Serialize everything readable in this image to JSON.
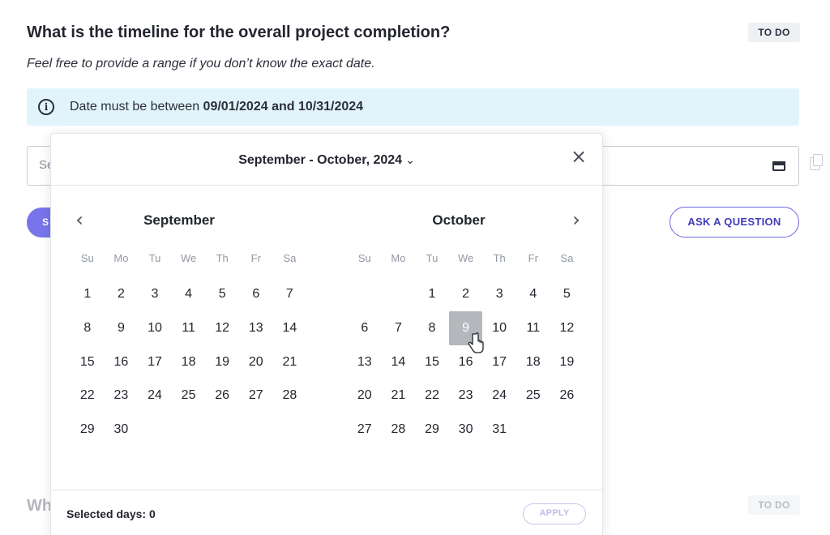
{
  "question": {
    "title": "What is the timeline for the overall project completion?",
    "hint": "Feel free to provide a range if you don’t know the exact date.",
    "status": "TO DO"
  },
  "info": {
    "prefix": "Date must be between ",
    "range": "09/01/2024 and 10/31/2024",
    "icon": "info-icon"
  },
  "date_input": {
    "placeholder": "Se",
    "icon": "calendar-icon"
  },
  "actions": {
    "submit_label": "S",
    "ask_label": "ASK A QUESTION"
  },
  "next_question": {
    "title": "Wh",
    "status": "TO DO"
  },
  "datepicker": {
    "title": "September - October, 2024",
    "title_chevron": "⌄",
    "close": "×",
    "prev": "‹",
    "next": "›",
    "weekdays": [
      "Su",
      "Mo",
      "Tu",
      "We",
      "Th",
      "Fr",
      "Sa"
    ],
    "months": [
      {
        "name": "September",
        "days": [
          "1",
          "2",
          "3",
          "4",
          "5",
          "6",
          "7",
          "8",
          "9",
          "10",
          "11",
          "12",
          "13",
          "14",
          "15",
          "16",
          "17",
          "18",
          "19",
          "20",
          "21",
          "22",
          "23",
          "24",
          "25",
          "26",
          "27",
          "28",
          "29",
          "30"
        ],
        "offset": 0
      },
      {
        "name": "October",
        "days": [
          "1",
          "2",
          "3",
          "4",
          "5",
          "6",
          "7",
          "8",
          "9",
          "10",
          "11",
          "12",
          "13",
          "14",
          "15",
          "16",
          "17",
          "18",
          "19",
          "20",
          "21",
          "22",
          "23",
          "24",
          "25",
          "26",
          "27",
          "28",
          "29",
          "30",
          "31"
        ],
        "offset": 2
      }
    ],
    "hovered_day": {
      "month": "October",
      "day": "9"
    },
    "footer": {
      "selected_days": "Selected days: 0",
      "apply_label": "APPLY"
    }
  }
}
